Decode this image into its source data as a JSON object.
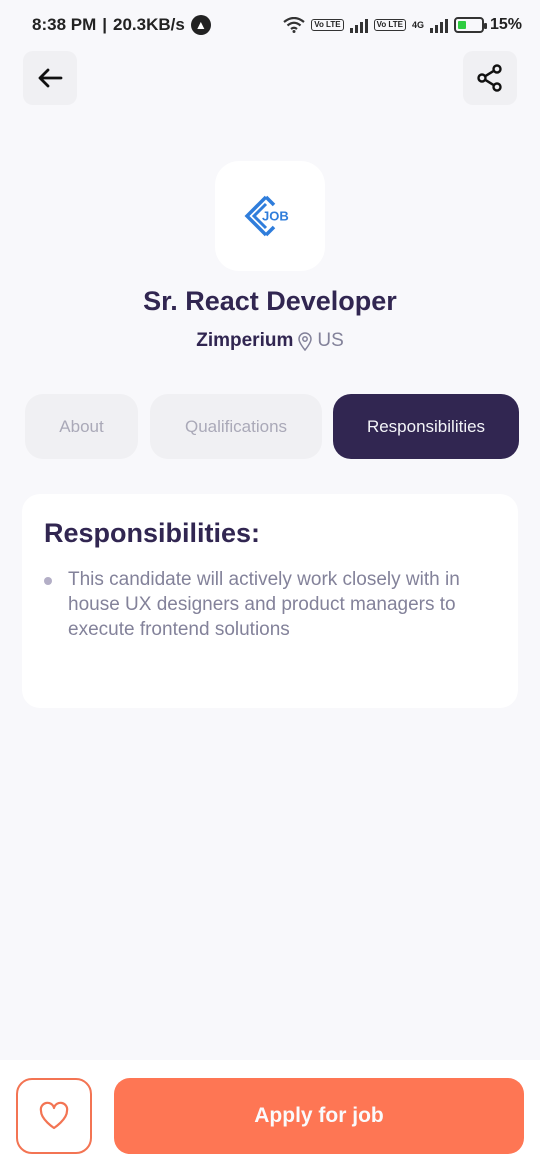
{
  "status_bar": {
    "time": "8:38 PM",
    "speed": "20.3KB/s",
    "volte1": "Vo LTE",
    "volte2": "Vo LTE",
    "net_type": "4G",
    "battery": "15%"
  },
  "header": {
    "back_icon": "arrow-left-icon",
    "share_icon": "share-icon"
  },
  "job": {
    "logo_text": "JOB",
    "title": "Sr. React Developer",
    "company": "Zimperium",
    "location": "US"
  },
  "tabs": [
    {
      "label": "About",
      "active": false
    },
    {
      "label": "Qualifications",
      "active": false
    },
    {
      "label": "Responsibilities",
      "active": true
    }
  ],
  "section": {
    "title": "Responsibilities:",
    "points": [
      "This candidate will actively work closely with in house UX designers and product managers to execute frontend solutions"
    ]
  },
  "footer": {
    "like_icon": "heart-icon",
    "apply_label": "Apply for job"
  },
  "colors": {
    "primary": "#312651",
    "accent": "#FE7654",
    "gray": "#83829A"
  }
}
